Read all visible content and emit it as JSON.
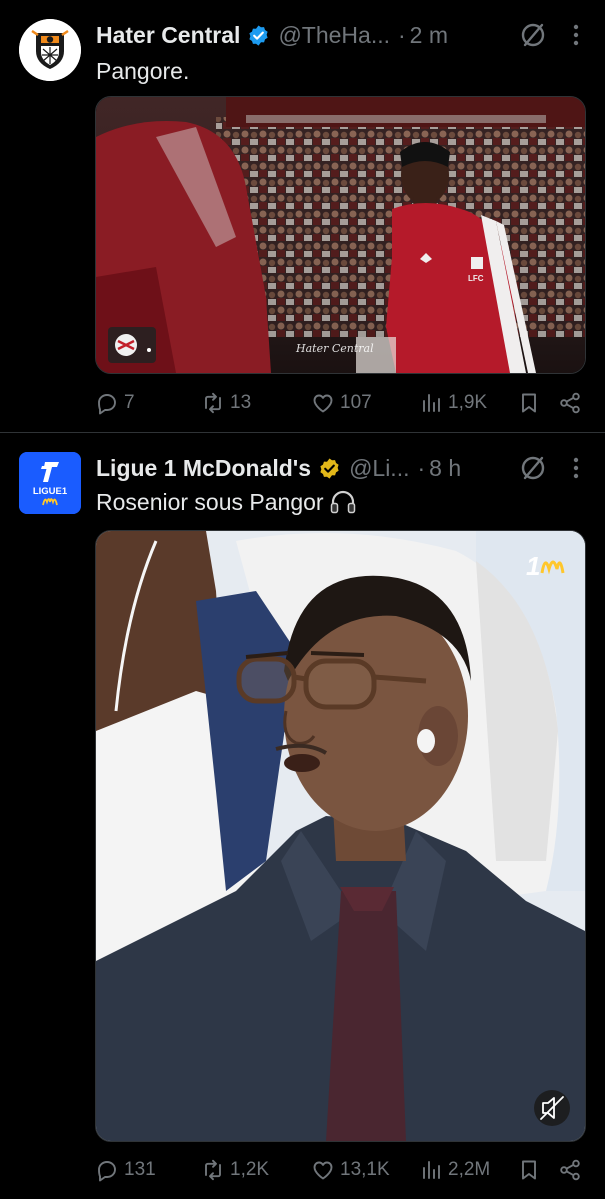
{
  "tweets": [
    {
      "author": "Hater Central",
      "handle": "@TheHa...",
      "dot": "·",
      "time": "2 m",
      "text": "Pangore.",
      "media": {
        "watermark": "Hater Central",
        "jersey_text": "LFC"
      },
      "stats": {
        "replies": "7",
        "reposts": "13",
        "likes": "107",
        "views": "1,9K"
      }
    },
    {
      "author": "Ligue 1 McDonald's",
      "handle": "@Li...",
      "dot": "·",
      "time": "8 h",
      "text": "Rosenior sous Pangor",
      "avatar_text": "LIGUE1",
      "stats": {
        "replies": "131",
        "reposts": "1,2K",
        "likes": "13,1K",
        "views": "2,2M"
      }
    }
  ],
  "colors": {
    "background": "#000000",
    "muted": "#71767b",
    "verified_blue": "#1d9bf0",
    "verified_gold": "#e2b719",
    "ligue1_blue": "#1a5cff"
  },
  "icons": [
    "verified-badge-icon",
    "grok-icon",
    "more-icon",
    "reply-icon",
    "repost-icon",
    "like-icon",
    "views-icon",
    "bookmark-icon",
    "share-icon",
    "headphones-icon",
    "mute-icon"
  ]
}
